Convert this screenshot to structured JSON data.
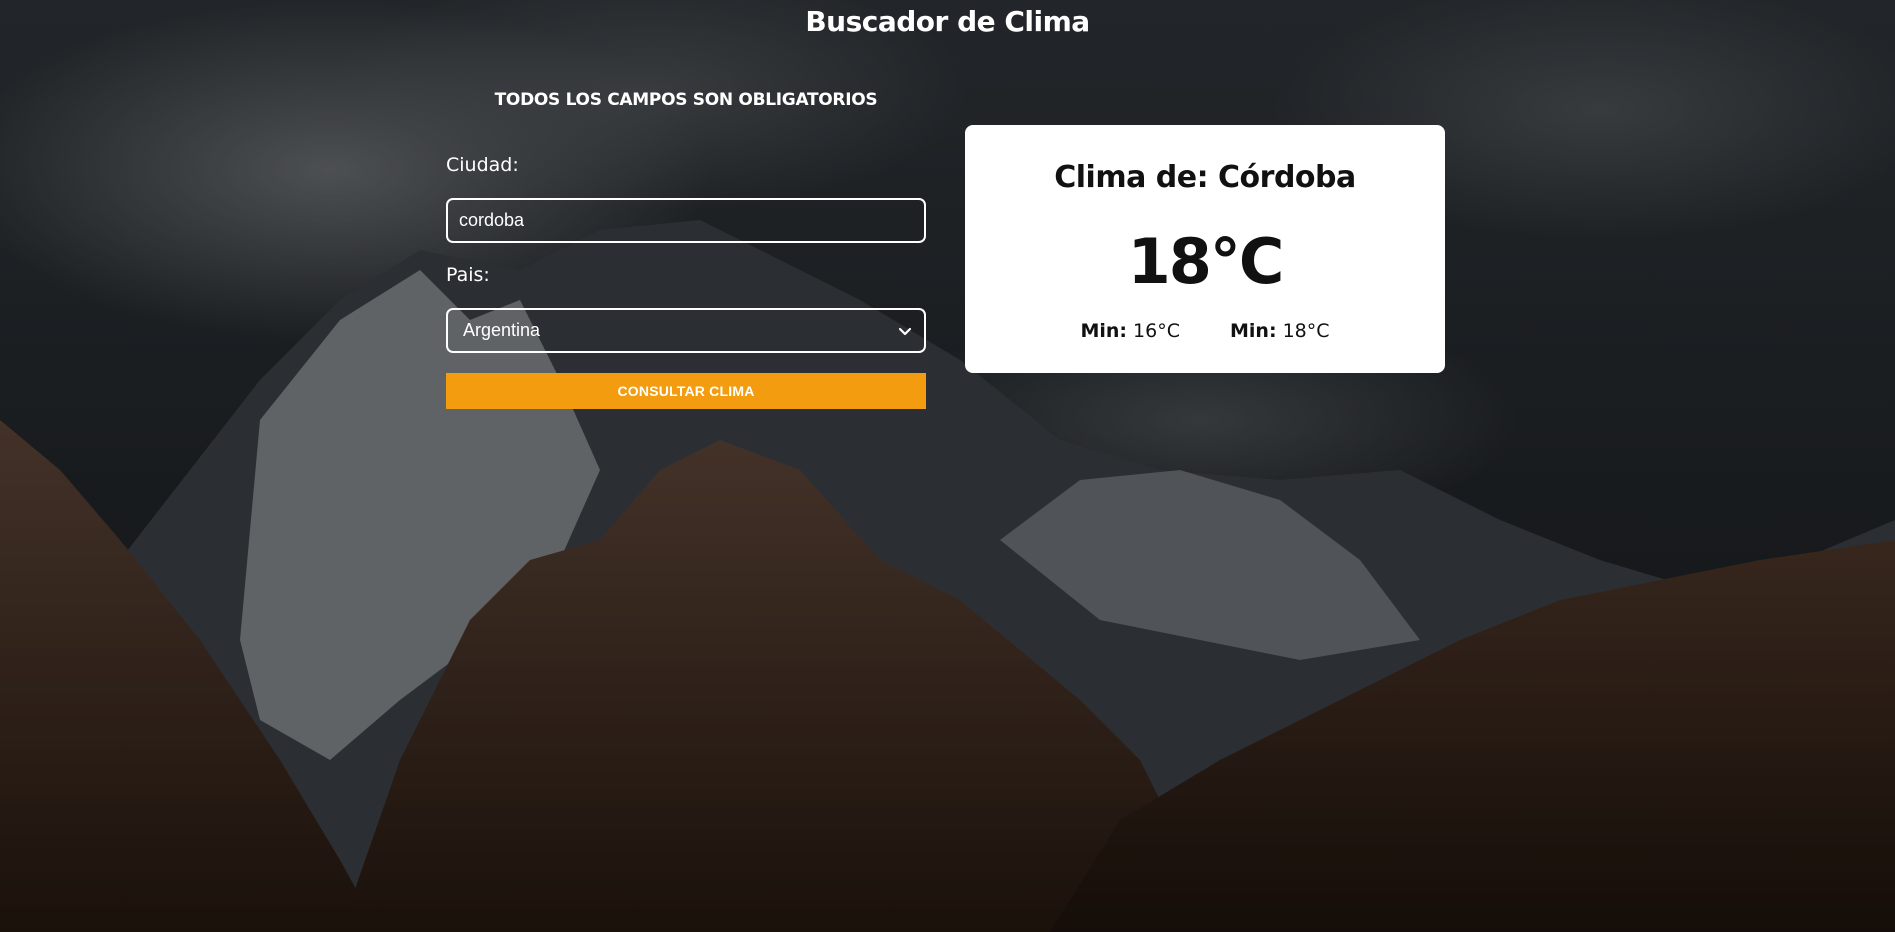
{
  "page": {
    "title": "Buscador de Clima"
  },
  "form": {
    "notice": "TODOS LOS CAMPOS SON OBLIGATORIOS",
    "city_label": "Ciudad:",
    "city_value": "cordoba",
    "country_label": "Pais:",
    "country_selected": "Argentina",
    "submit_label": "CONSULTAR CLIMA"
  },
  "result": {
    "title": "Clima de: Córdoba",
    "temperature": "18°C",
    "min_label": "Min:",
    "min_value": "16°C",
    "max_label": "Min:",
    "max_value": "18°C"
  },
  "colors": {
    "accent": "#f39c0f",
    "card_background": "#ffffff",
    "page_background": "#1a1c1f"
  },
  "icons": {
    "select_arrow": "chevron-down-icon"
  }
}
